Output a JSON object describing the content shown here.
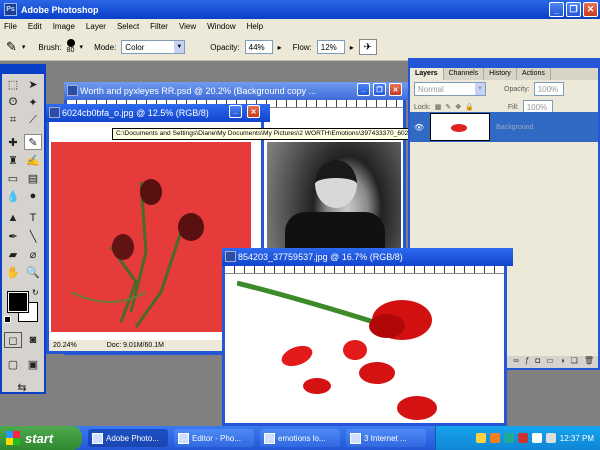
{
  "app": {
    "title": "Adobe Photoshop"
  },
  "menu": [
    "File",
    "Edit",
    "Image",
    "Layer",
    "Select",
    "Filter",
    "View",
    "Window",
    "Help"
  ],
  "options": {
    "brush_label": "Brush:",
    "brush_size": "80",
    "mode_label": "Mode:",
    "mode_value": "Color",
    "opacity_label": "Opacity:",
    "opacity_value": "44%",
    "flow_label": "Flow:",
    "flow_value": "12%"
  },
  "windows": {
    "back": {
      "title": "Worth and pyxleyes RR.psd @ 20.2% (Background copy ..."
    },
    "left": {
      "title": "6024cb0bfa_o.jpg @ 12.5% (RGB/8)",
      "zoom": "20.24%",
      "doc": "Doc: 9.01M/60.1M"
    },
    "front": {
      "title": "854203_37759537.jpg @ 16.7% (RGB/8)"
    }
  },
  "tooltip": "C:\\Documents and Settings\\Diane\\My Documents\\My Pictures\\2 WORTH\\Emotions\\397433370_6024cb0bfa_o.jpg @ 12.5% (RGB/8*)",
  "layers": {
    "tabs": [
      "Layers",
      "Channels",
      "History",
      "Actions"
    ],
    "blend": "Normal",
    "opacity_label": "Opacity:",
    "opacity_value": "100%",
    "lock_label": "Lock:",
    "fill_label": "Fill:",
    "fill_value": "100%",
    "layer_name": "Background"
  },
  "taskbar": {
    "start": "start",
    "items": [
      "Adobe Photo...",
      "Editor - Pho...",
      "emotions lo...",
      "3 Internet ..."
    ],
    "clock": "12:37 PM"
  },
  "colors": {
    "xp_blue": "#2456d6",
    "red_canvas": "#e53b3b",
    "chrome": "#ece9d8"
  }
}
